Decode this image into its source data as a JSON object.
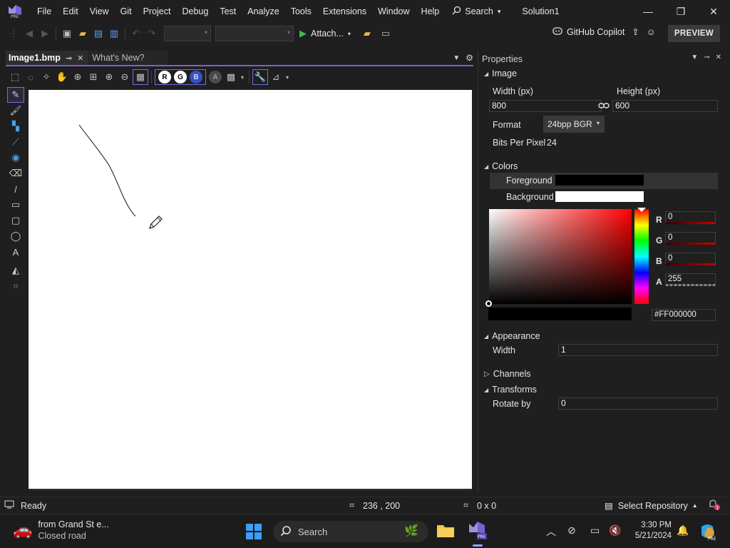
{
  "menu": {
    "items": [
      "File",
      "Edit",
      "View",
      "Git",
      "Project",
      "Debug",
      "Test",
      "Analyze",
      "Tools",
      "Extensions",
      "Window",
      "Help"
    ],
    "search_label": "Search",
    "solution_name": "Solution1"
  },
  "toolbar": {
    "attach_label": "Attach...",
    "copilot_label": "GitHub Copilot",
    "preview_label": "PREVIEW"
  },
  "tabs": {
    "active": "Image1.bmp",
    "inactive": "What's New?"
  },
  "image_toolbar": {
    "channels": [
      "R",
      "G",
      "B",
      "A"
    ]
  },
  "properties": {
    "title": "Properties",
    "image_section": "Image",
    "width_label": "Width (px)",
    "width_value": "800",
    "height_label": "Height (px)",
    "height_value": "600",
    "format_label": "Format",
    "format_value": "24bpp BGR",
    "bpp_label": "Bits Per Pixel",
    "bpp_value": "24",
    "colors_section": "Colors",
    "foreground_label": "Foreground",
    "foreground_color": "#000000",
    "background_label": "Background",
    "background_color": "#ffffff",
    "picker": {
      "r_label": "R",
      "r_value": "0",
      "g_label": "G",
      "g_value": "0",
      "b_label": "B",
      "b_value": "0",
      "a_label": "A",
      "a_value": "255",
      "hex_value": "#FF000000"
    },
    "appearance_section": "Appearance",
    "line_width_label": "Width",
    "line_width_value": "1",
    "channels_section": "Channels",
    "transforms_section": "Transforms",
    "rotate_label": "Rotate by",
    "rotate_value": "0"
  },
  "status": {
    "ready": "Ready",
    "cursor_pos": "236 , 200",
    "selection_size": "0 x 0",
    "repo_label": "Select Repository"
  },
  "taskbar": {
    "weather_title": "from Grand St e...",
    "weather_sub": "Closed road",
    "search_label": "Search",
    "time": "3:30 PM",
    "date": "5/21/2024",
    "notification_count": "1"
  },
  "colors": {
    "accent": "#7b5fd6",
    "channel_active": "#6e6ee6"
  }
}
